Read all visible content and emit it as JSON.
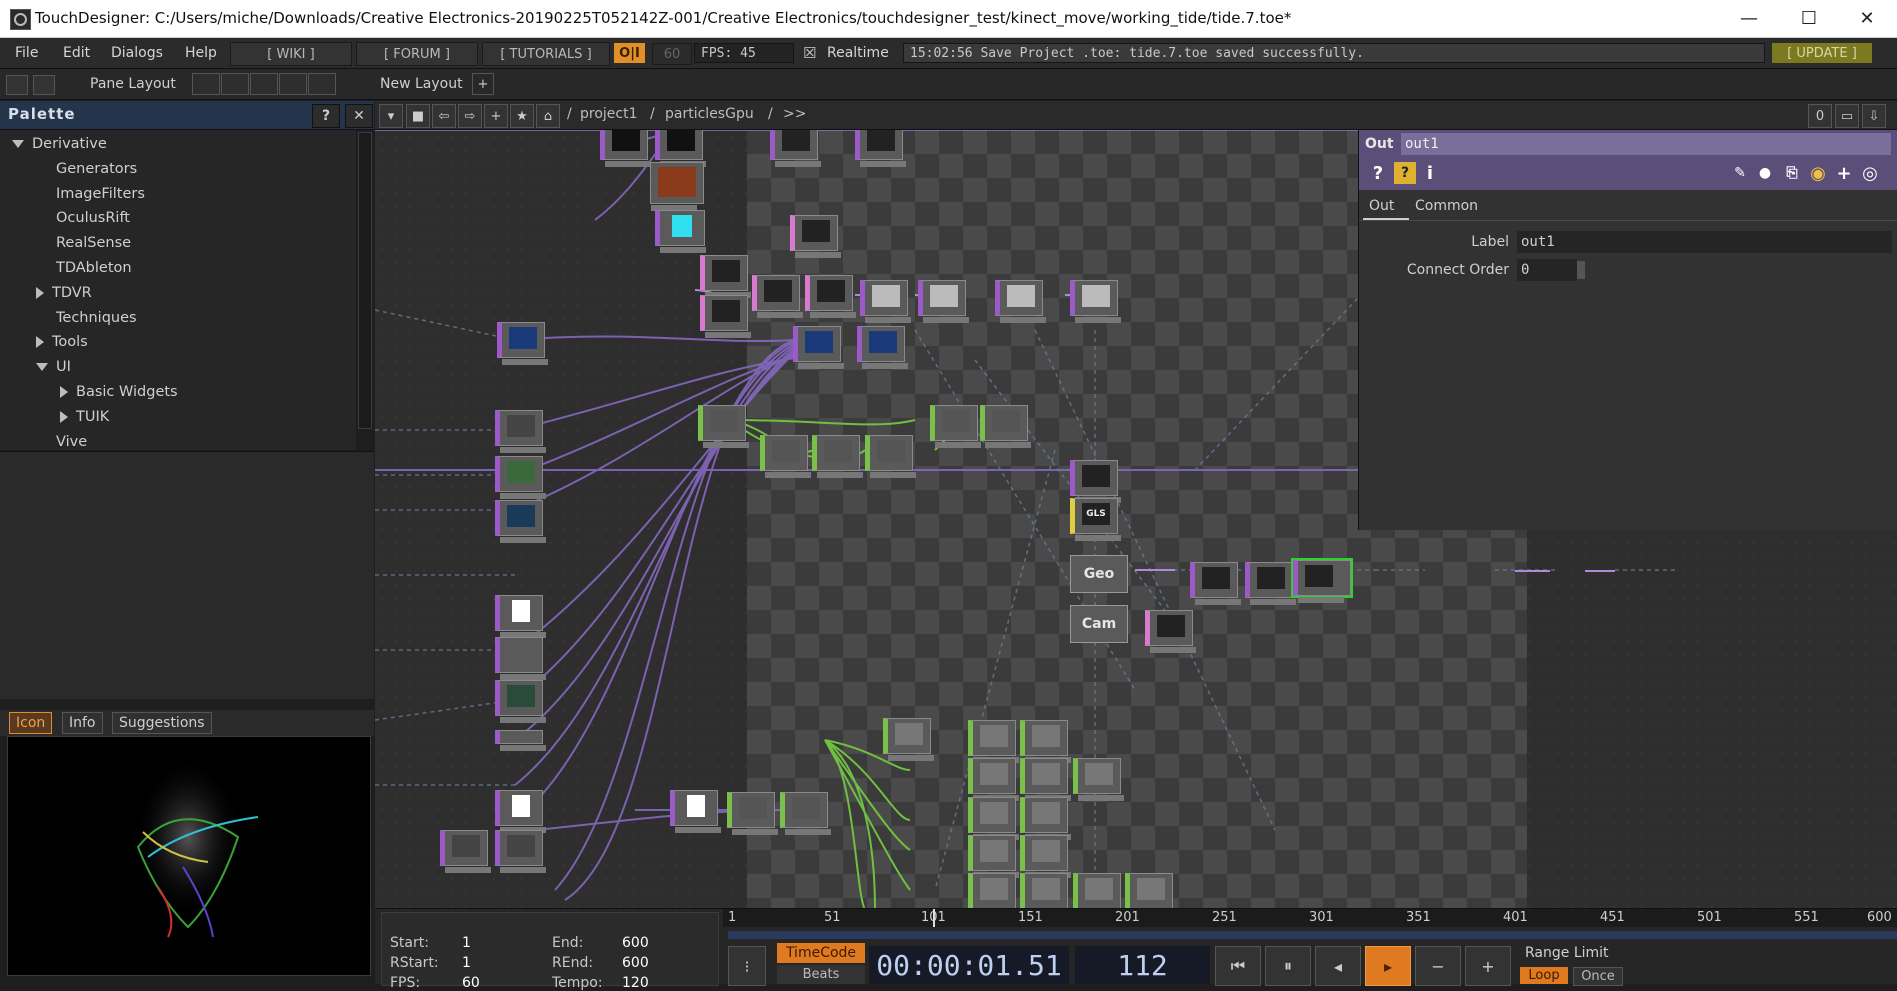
{
  "window": {
    "title": "TouchDesigner: C:/Users/miche/Downloads/Creative Electronics-20190225T052142Z-001/Creative Electronics/touchdesigner_test/kinect_move/working_tide/tide.7.toe*",
    "min": "—",
    "max": "☐",
    "close": "✕"
  },
  "menubar": {
    "items": [
      "File",
      "Edit",
      "Dialogs",
      "Help"
    ],
    "wiki": "[ WIKI ]",
    "forum": "[ FORUM ]",
    "tutorials": "[ TUTORIALS ]",
    "oi": "O|I",
    "sixty": "60",
    "fps_label": "FPS:  45",
    "realtime_check": "☒",
    "realtime": "Realtime",
    "status": "15:02:56 Save Project .toe: tide.7.toe saved successfully.",
    "update": "[ UPDATE ]"
  },
  "layoutbar": {
    "pane_layout": "Pane Layout",
    "new_layout": "New Layout",
    "plus": "+"
  },
  "palette": {
    "title": "Palette",
    "help": "?",
    "close": "✕",
    "tree": [
      {
        "label": "Derivative",
        "indent": 0,
        "arrow": "down"
      },
      {
        "label": "Generators",
        "indent": 1,
        "arrow": "none"
      },
      {
        "label": "ImageFilters",
        "indent": 1,
        "arrow": "none"
      },
      {
        "label": "OculusRift",
        "indent": 1,
        "arrow": "none"
      },
      {
        "label": "RealSense",
        "indent": 1,
        "arrow": "none"
      },
      {
        "label": "TDAbleton",
        "indent": 1,
        "arrow": "none"
      },
      {
        "label": "TDVR",
        "indent": 1,
        "arrow": "right"
      },
      {
        "label": "Techniques",
        "indent": 1,
        "arrow": "none"
      },
      {
        "label": "Tools",
        "indent": 1,
        "arrow": "right"
      },
      {
        "label": "UI",
        "indent": 1,
        "arrow": "down"
      },
      {
        "label": "Basic Widgets",
        "indent": 2,
        "arrow": "right"
      },
      {
        "label": "TUIK",
        "indent": 2,
        "arrow": "right"
      },
      {
        "label": "Vive",
        "indent": 1,
        "arrow": "none"
      }
    ]
  },
  "viewer_tabs": [
    "Icon",
    "Info",
    "Suggestions"
  ],
  "network": {
    "path": [
      "/",
      "project1",
      "/",
      "particlesGpu",
      "/",
      ">>"
    ],
    "counter": "0"
  },
  "param": {
    "op_type": "Out",
    "op_name": "out1",
    "tabs": [
      "Out",
      "Common"
    ],
    "fields": [
      {
        "label": "Label",
        "value": "out1"
      },
      {
        "label": "Connect Order",
        "value": "0"
      }
    ]
  },
  "nodes": {
    "geo": "Geo",
    "cam": "Cam",
    "glsl": "GLS"
  },
  "timeline": {
    "start_label": "Start:",
    "start": "1",
    "end_label": "End:",
    "end": "600",
    "rstart_label": "RStart:",
    "rstart": "1",
    "rend_label": "REnd:",
    "rend": "600",
    "fps_label": "FPS:",
    "fps": "60",
    "tempo_label": "Tempo:",
    "tempo": "120",
    "ticks": [
      "1",
      "51",
      "101",
      "151",
      "201",
      "251",
      "301",
      "351",
      "401",
      "451",
      "501",
      "551",
      "600"
    ],
    "timecode_label": "TimeCode",
    "beats_label": "Beats",
    "timecode": "00:00:01.51",
    "frame": "112",
    "range_limit": "Range Limit",
    "loop": "Loop",
    "once": "Once"
  }
}
